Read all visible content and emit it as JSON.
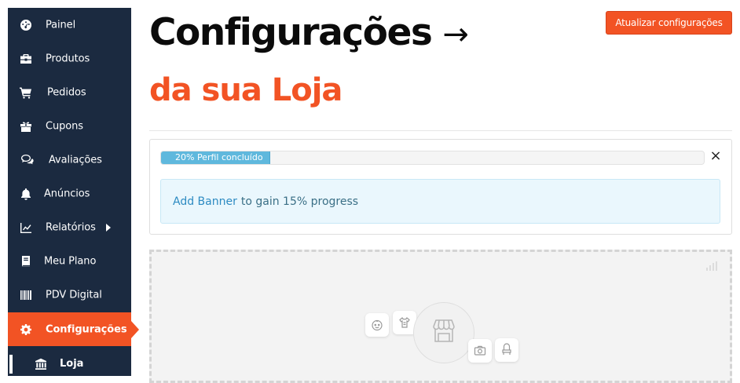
{
  "sidebar": {
    "items": [
      {
        "label": "Painel",
        "icon": "dashboard-icon"
      },
      {
        "label": "Produtos",
        "icon": "briefcase-icon"
      },
      {
        "label": "Pedidos",
        "icon": "cart-icon"
      },
      {
        "label": "Cupons",
        "icon": "gift-icon"
      },
      {
        "label": "Avaliações",
        "icon": "comments-icon"
      },
      {
        "label": "Anúncios",
        "icon": "bell-icon"
      },
      {
        "label": "Relatórios",
        "icon": "chart-line-icon"
      },
      {
        "label": "Meu Plano",
        "icon": "book-icon"
      },
      {
        "label": "PDV Digital",
        "icon": "barcode-icon"
      },
      {
        "label": "Configurações",
        "icon": "gear-icon",
        "active": true
      }
    ],
    "subitem": {
      "label": "Loja",
      "icon": "bank-icon"
    }
  },
  "header": {
    "title_line1": "Configurações",
    "title_arrow": "→",
    "title_line2": "da sua Loja",
    "update_button": "Atualizar configurações"
  },
  "progress": {
    "label": "20% Perfil concluído",
    "percent": 20,
    "close_glyph": "×",
    "notice_link": "Add Banner",
    "notice_text": "to gain 15% progress"
  },
  "colors": {
    "brand": "#f25324",
    "sidebar_bg": "#1b2a40",
    "progress_fill": "#5fb8dd",
    "notice_bg": "#eaf7fd"
  }
}
